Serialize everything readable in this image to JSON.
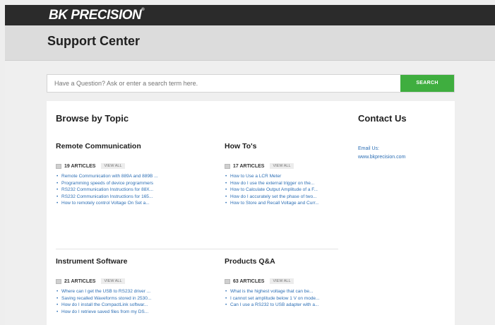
{
  "header": {
    "logo_main": "BK PRECISION",
    "logo_mark": "®"
  },
  "title_bar": {
    "title": "Support Center"
  },
  "search": {
    "placeholder": "Have a Question? Ask or enter a search term here.",
    "button_label": "SEARCH"
  },
  "browse": {
    "title": "Browse by Topic",
    "topics": [
      {
        "title": "Remote Communication",
        "count": "19 ARTICLES",
        "view_all": "VIEW ALL",
        "items": [
          "Remote Communication with 889A and 889B ...",
          "Programming speeds of device programmers",
          "RS232 Communication Instructions for 88X...",
          "RS232 Communication Instructions for 165...",
          "How to remotely control Voltage On Set a..."
        ]
      },
      {
        "title": "How To's",
        "count": "17 ARTICLES",
        "view_all": "VIEW ALL",
        "items": [
          "How to Use a LCR Meter",
          "How do I use the external trigger on the...",
          "How to Calculate Output Amplitude of a F...",
          "How do I accurately set the phase of two...",
          "How to Store and Recall Voltage and Curr..."
        ]
      },
      {
        "title": "Instrument Software",
        "count": "21 ARTICLES",
        "view_all": "VIEW ALL",
        "items": [
          "Where can I get the USB to RS232 driver ...",
          "Saving recalled Waveforms stored in 2530...",
          "How do I install the CompactLink softwar...",
          "How do I retrieve saved files from my DS..."
        ]
      },
      {
        "title": "Products Q&A",
        "count": "63 ARTICLES",
        "view_all": "VIEW ALL",
        "items": [
          "What is the highest voltage that can be...",
          "I cannot set amplitude below 1 V on mode...",
          "Can I use a RS232 to USB adapter with a..."
        ]
      }
    ]
  },
  "contact": {
    "title": "Contact Us",
    "email_label": "Email Us:",
    "email": "www.bkprecision.com"
  }
}
